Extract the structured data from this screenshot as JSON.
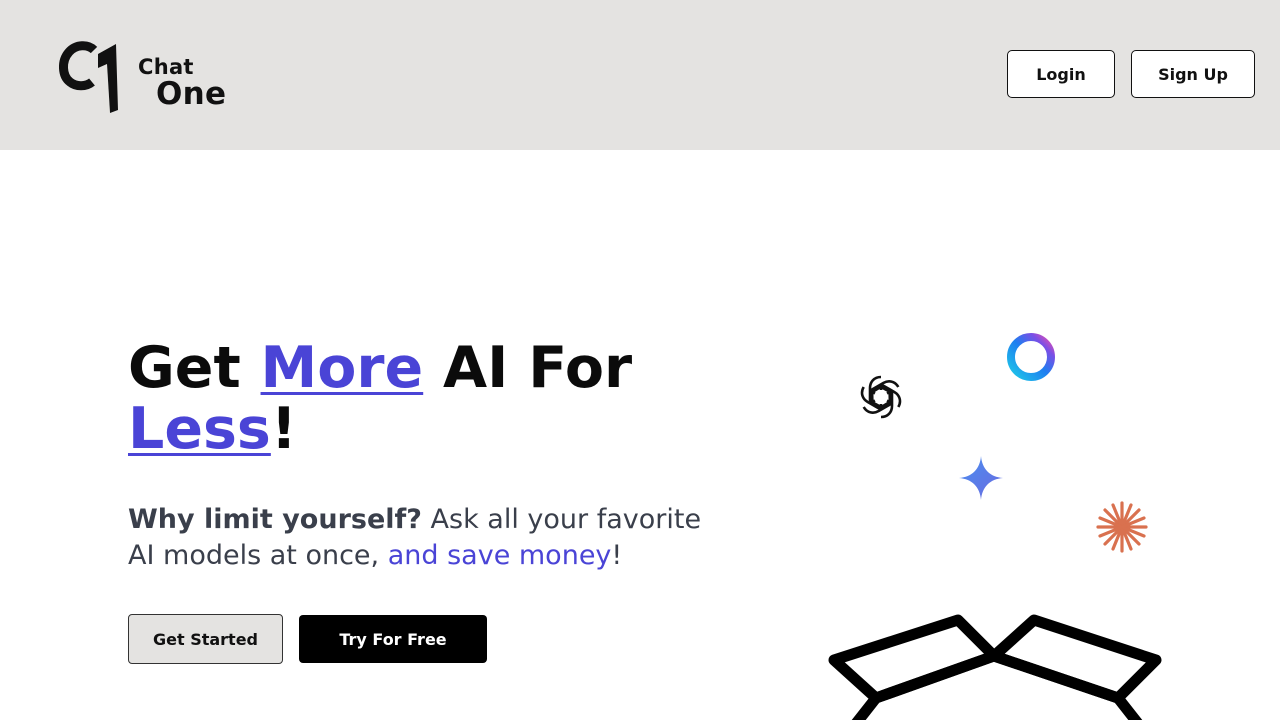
{
  "brand": {
    "line1": "Chat",
    "line2": "One"
  },
  "header": {
    "login_label": "Login",
    "signup_label": "Sign Up"
  },
  "hero": {
    "title_part1": "Get ",
    "title_accent1": "More",
    "title_part2": " AI For ",
    "title_accent2": "Less",
    "title_part3": "!",
    "sub_bold": "Why limit yourself?",
    "sub_text": " Ask all your favorite AI models at once, ",
    "sub_accent": "and save money",
    "sub_end": "!"
  },
  "cta": {
    "get_started_label": "Get Started",
    "try_free_label": "Try For Free"
  },
  "icons": [
    "openai-icon",
    "copilot-ring-icon",
    "gemini-star-icon",
    "claude-burst-icon",
    "open-box-icon"
  ],
  "colors": {
    "accent": "#4a44d6",
    "header_bg": "#e4e3e1",
    "claude": "#d9714f"
  }
}
